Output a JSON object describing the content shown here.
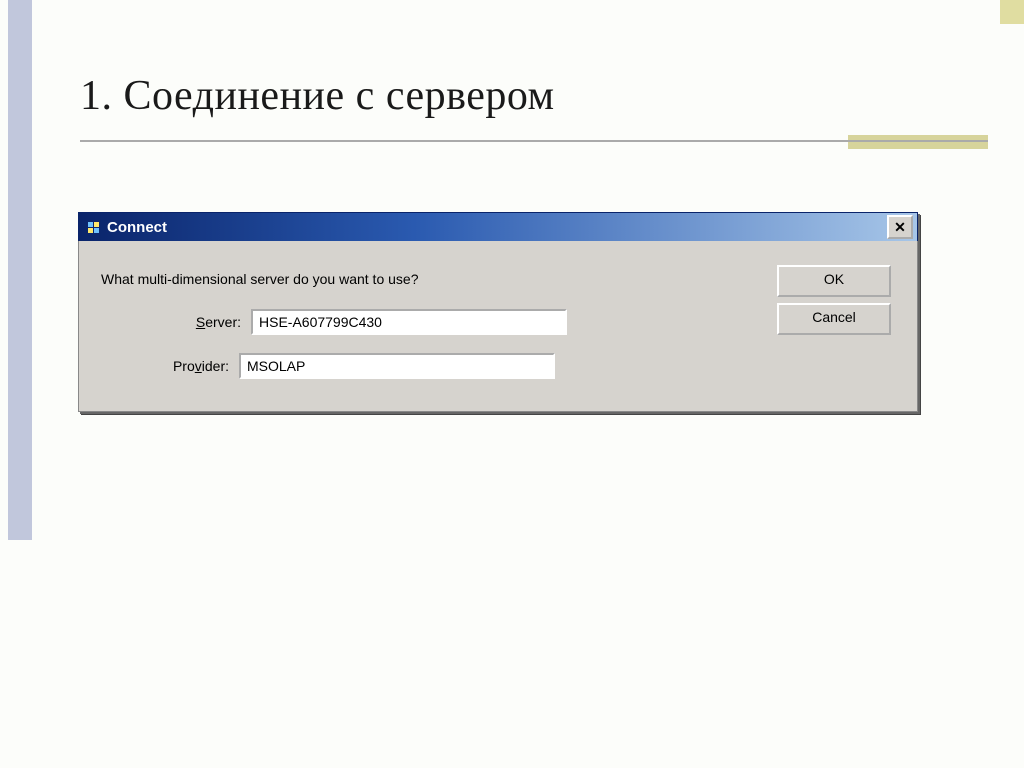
{
  "slide": {
    "title": "1. Соединение с сервером"
  },
  "dialog": {
    "title": "Connect",
    "prompt": "What multi-dimensional server do you want to use?",
    "server_label_pre": "S",
    "server_label_post": "erver:",
    "server_value": "HSE-A607799C430",
    "provider_label_pre": "Pro",
    "provider_label_u": "v",
    "provider_label_post": "ider:",
    "provider_value": "MSOLAP",
    "ok_label": "OK",
    "cancel_label": "Cancel",
    "close_glyph": "✕"
  }
}
